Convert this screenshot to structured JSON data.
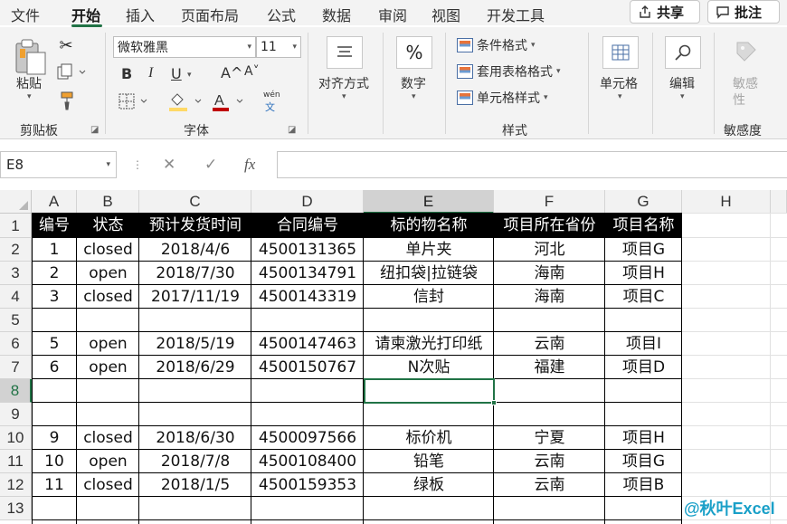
{
  "tabs": [
    "文件",
    "开始",
    "插入",
    "页面布局",
    "公式",
    "数据",
    "审阅",
    "视图",
    "开发工具"
  ],
  "active_tab": "开始",
  "share_label": "共享",
  "comments_label": "批注",
  "ribbon": {
    "clipboard": {
      "paste_label": "粘贴",
      "group_label": "剪贴板"
    },
    "font": {
      "font_name": "微软雅黑",
      "font_size": "11",
      "bold": "B",
      "italic": "I",
      "underline": "U",
      "grow": "A^",
      "shrink": "A˅",
      "phonetic_top": "wén",
      "phonetic_bottom": "文",
      "group_label": "字体",
      "fill_color": "#ffd966",
      "font_color": "#c00000"
    },
    "alignment": {
      "label": "对齐方式"
    },
    "number": {
      "label": "数字",
      "symbol": "%"
    },
    "styles": {
      "conditional": "条件格式",
      "table_format": "套用表格格式",
      "cell_styles": "单元格样式",
      "group_label": "样式"
    },
    "cells": {
      "label": "单元格"
    },
    "editing": {
      "label": "编辑"
    },
    "sensitivity": {
      "label_line1": "敏感",
      "label_line2": "性",
      "group_label": "敏感度"
    }
  },
  "formula_bar": {
    "name_box": "E8",
    "cancel": "✕",
    "enter": "✓",
    "fx": "fx",
    "content": ""
  },
  "columns": [
    "A",
    "B",
    "C",
    "D",
    "E",
    "F",
    "G",
    "H"
  ],
  "selected_column": "E",
  "rows": [
    "1",
    "2",
    "3",
    "4",
    "5",
    "6",
    "7",
    "8",
    "9",
    "10",
    "11",
    "12",
    "13"
  ],
  "selected_row": "8",
  "header": [
    "编号",
    "状态",
    "预计发货时间",
    "合同编号",
    "标的物名称",
    "项目所在省份",
    "项目名称"
  ],
  "data": [
    [
      "1",
      "closed",
      "2018/4/6",
      "4500131365",
      "单片夹",
      "河北",
      "项目G"
    ],
    [
      "2",
      "open",
      "2018/7/30",
      "4500134791",
      "纽扣袋|拉链袋",
      "海南",
      "项目H"
    ],
    [
      "3",
      "closed",
      "2017/11/19",
      "4500143319",
      "信封",
      "海南",
      "项目C"
    ],
    [
      "",
      "",
      "",
      "",
      "",
      "",
      ""
    ],
    [
      "5",
      "open",
      "2018/5/19",
      "4500147463",
      "请柬激光打印纸",
      "云南",
      "项目I"
    ],
    [
      "6",
      "open",
      "2018/6/29",
      "4500150767",
      "N次贴",
      "福建",
      "项目D"
    ],
    [
      "",
      "",
      "",
      "",
      "",
      "",
      ""
    ],
    [
      "",
      "",
      "",
      "",
      "",
      "",
      ""
    ],
    [
      "9",
      "closed",
      "2018/6/30",
      "4500097566",
      "标价机",
      "宁夏",
      "项目H"
    ],
    [
      "10",
      "open",
      "2018/7/8",
      "4500108400",
      "铅笔",
      "云南",
      "项目G"
    ],
    [
      "11",
      "closed",
      "2018/1/5",
      "4500159353",
      "绿板",
      "云南",
      "项目B"
    ],
    [
      "",
      "",
      "",
      "",
      "",
      "",
      ""
    ]
  ],
  "watermark": "@秋叶Excel",
  "colors": {
    "accent": "#217346",
    "header_fill": "#000000",
    "header_text": "#ffffff"
  }
}
